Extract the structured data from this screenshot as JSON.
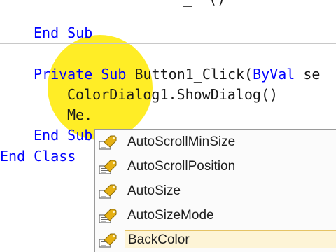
{
  "code": {
    "top_partial": "_  ()",
    "line_end_sub_1": {
      "kw1": "End",
      "kw2": "Sub"
    },
    "line_private_sub": {
      "kw_private": "Private",
      "kw_sub": "Sub",
      "name": "Button1_Click(",
      "kw_byval": "ByVal",
      "rest": " se"
    },
    "line_colordialog": "ColorDialog1.ShowDialog()",
    "line_me": "Me.",
    "line_end_sub_2": {
      "kw1": "End",
      "kw2": "Sub"
    },
    "line_end_class": {
      "kw1": "End",
      "kw2": "Class"
    }
  },
  "intellisense": {
    "items": [
      {
        "label": "AutoScrollMinSize",
        "icon": "property-icon",
        "selected": false
      },
      {
        "label": "AutoScrollPosition",
        "icon": "property-icon",
        "selected": false
      },
      {
        "label": "AutoSize",
        "icon": "property-icon",
        "selected": false
      },
      {
        "label": "AutoSizeMode",
        "icon": "property-icon",
        "selected": false
      },
      {
        "label": "BackColor",
        "icon": "property-icon",
        "selected": true
      }
    ]
  },
  "colors": {
    "keyword": "#0000ff",
    "cursor_highlight": "#ffea00",
    "selection_fill": "#fdf4d6",
    "selection_border": "#e5c365"
  }
}
